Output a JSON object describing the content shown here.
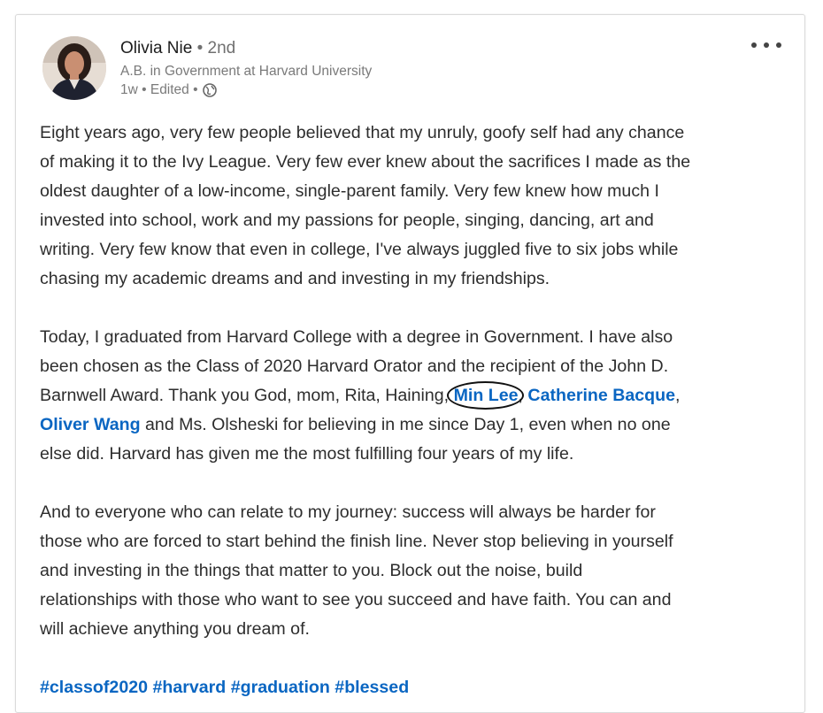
{
  "post": {
    "author": {
      "name": "Olivia Nie",
      "degree": "• 2nd",
      "headline": "A.B. in Government at Harvard University",
      "meta": "1w • Edited •"
    },
    "paragraph1": [
      "Eight years ago, very few people believed that my unruly, goofy self had any chance",
      "of making it to the Ivy League. Very few ever knew about the sacrifices I made as the",
      "oldest daughter of a low-income, single-parent family. Very few knew how much I",
      "invested into school, work and my passions for people, singing, dancing, art and",
      "writing. Very few know that even in college, I've always juggled five to six jobs while",
      "chasing my academic dreams and and investing in my friendships."
    ],
    "paragraph2": {
      "line1": "Today, I graduated from Harvard College with a degree in Government. I have also",
      "line2": "been chosen as the Class of 2020 Harvard Orator and the recipient of the John D.",
      "line3_prefix": "Barnwell Award. Thank you God, mom, Rita, Haining, ",
      "mention1": "Min Lee",
      "sep1": ", ",
      "mention2": "Catherine Bacque",
      "line3_suffix": ",",
      "mention3": "Oliver Wang",
      "line4_suffix": " and Ms. Olsheski for believing in me since Day 1, even when no one",
      "line5": "else did. Harvard has given me the most fulfilling four years of my life."
    },
    "paragraph3": [
      "And to everyone who can relate to my journey: success will always be harder for",
      "those who are forced to start behind the finish line. Never stop believing in yourself",
      "and investing in the things that matter to you. Block out the noise, build",
      "relationships with those who want to see you succeed and have faith. You can and",
      "will achieve anything you dream of."
    ],
    "hashtags": [
      "#classof2020",
      "#harvard",
      "#graduation",
      "#blessed"
    ]
  },
  "icons": {
    "globe": "globe-icon",
    "more": "more-options-icon"
  },
  "colors": {
    "link": "#0a66c2",
    "text": "#2d2d2d",
    "secondary": "#7a7a7a"
  }
}
